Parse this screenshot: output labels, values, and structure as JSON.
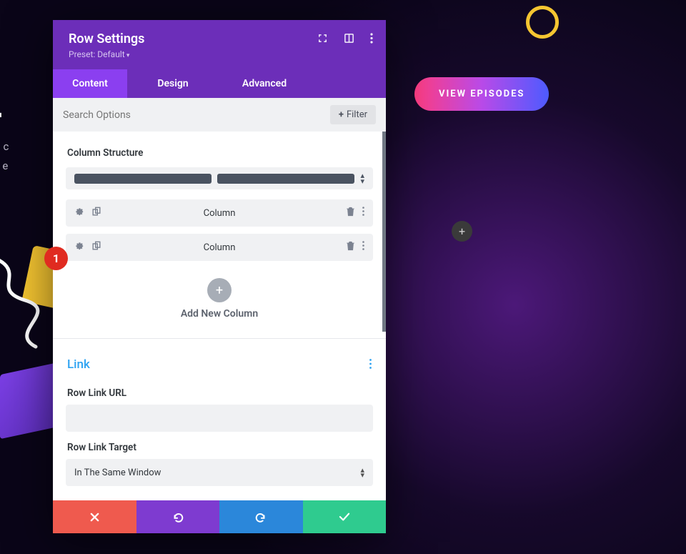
{
  "background": {
    "headline": "t L",
    "body_line1": "t amet, c",
    "body_line2": "finibus e",
    "button": "VIEW EPISODES"
  },
  "badge": "1",
  "modal": {
    "title": "Row Settings",
    "preset": "Preset: Default",
    "tabs": {
      "content": "Content",
      "design": "Design",
      "advanced": "Advanced"
    },
    "search_placeholder": "Search Options",
    "filter_label": "Filter",
    "sections": {
      "column_structure": "Column Structure",
      "columns": [
        "Column",
        "Column"
      ],
      "add_new_column": "Add New Column",
      "link_heading": "Link",
      "row_link_url": "Row Link URL",
      "row_link_target": "Row Link Target",
      "target_value": "In The Same Window"
    }
  }
}
